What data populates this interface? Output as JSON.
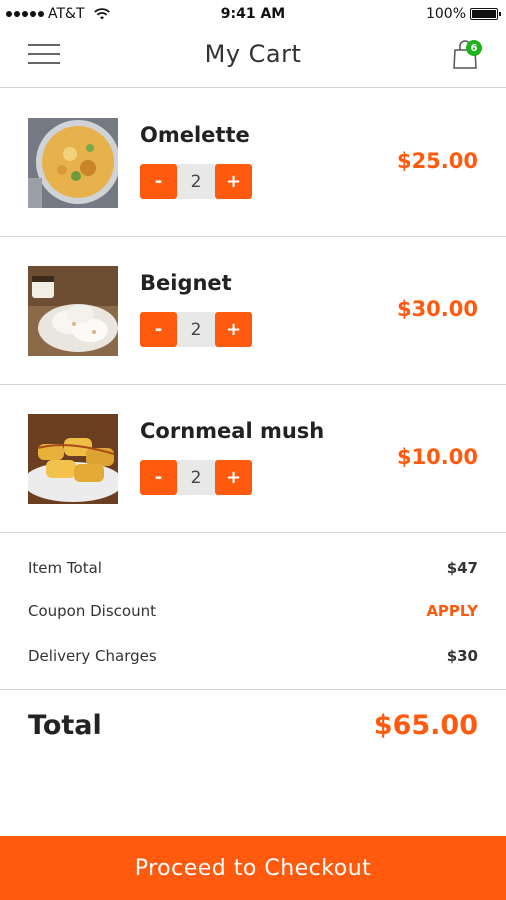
{
  "status_bar": {
    "carrier": "AT&T",
    "time": "9:41 AM",
    "battery": "100%",
    "battery_level": 1.0
  },
  "header": {
    "title": "My Cart",
    "menu_icon": "hamburger-menu-icon",
    "cart_icon": "shopping-bag-icon",
    "cart_count": "6"
  },
  "items": [
    {
      "name": "Omelette",
      "qty": "2",
      "price": "$25.00",
      "minus": "-",
      "plus": "+"
    },
    {
      "name": "Beignet",
      "qty": "2",
      "price": "$30.00",
      "minus": "-",
      "plus": "+"
    },
    {
      "name": "Cornmeal mush",
      "qty": "2",
      "price": "$10.00",
      "minus": "-",
      "plus": "+"
    }
  ],
  "summary": {
    "item_total_label": "Item Total",
    "item_total_value": "$47",
    "coupon_label": "Coupon Discount",
    "coupon_action": "APPLY",
    "delivery_label": "Delivery Charges",
    "delivery_value": "$30"
  },
  "total": {
    "label": "Total",
    "value": "$65.00"
  },
  "checkout": {
    "label": "Proceed to Checkout"
  },
  "colors": {
    "accent": "#ff5a0d",
    "badge": "#1db31d",
    "divider": "#d6d6d6"
  }
}
